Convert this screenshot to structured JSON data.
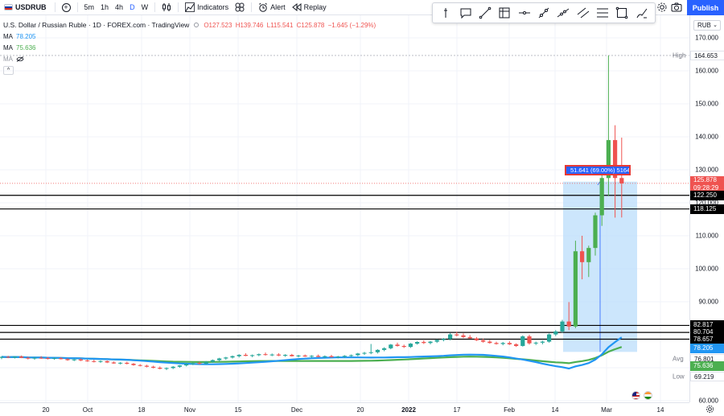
{
  "toolbar": {
    "symbol": "USDRUB",
    "intervals": [
      "5m",
      "1h",
      "4h",
      "D",
      "W"
    ],
    "active_interval": "D",
    "indicators_label": "Indicators",
    "alert_label": "Alert",
    "replay_label": "Replay",
    "publish_label": "Publish"
  },
  "legend": {
    "title": "U.S. Dollar / Russian Ruble · 1D · FOREX.com · TradingView",
    "open": "O127.523",
    "high": "H139.746",
    "low": "L115.541",
    "close": "C125.878",
    "change": "−1.645 (−1.29%)",
    "ma1_label": "MA",
    "ma1_value": "78.205",
    "ma2_label": "MA",
    "ma2_value": "75.636",
    "ma3_label": "MA"
  },
  "price_axis": {
    "currency": "RUB",
    "ticks": [
      "170.000",
      "160.000",
      "150.000",
      "140.000",
      "130.000",
      "120.000",
      "110.000",
      "100.000",
      "90.000",
      "80.000",
      "70.000",
      "60.000"
    ],
    "tags": {
      "high": "164.653",
      "high_label": "High",
      "last": "125.878",
      "countdown": "09:28:29",
      "line1": "122.250",
      "line2": "118.125",
      "line3": "82.817",
      "line4": "80.704",
      "line5": "78.657",
      "ma1": "78.205",
      "avg": "76.801",
      "avg_label": "Avg",
      "ma2": "75.636",
      "low": "69.219",
      "low_label": "Low"
    }
  },
  "time_axis": {
    "labels": [
      "20",
      "Oct",
      "18",
      "Nov",
      "15",
      "Dec",
      "20",
      "2022",
      "17",
      "Feb",
      "14",
      "Mar",
      "14"
    ]
  },
  "measure": {
    "label": "51.641 (69.00%) 5164"
  },
  "colors": {
    "up": "#26a69a",
    "down": "#ef5350",
    "up_bright": "#4caf50",
    "ma_blue": "#2196f3",
    "ma_green": "#4caf50",
    "accent": "#2962ff",
    "measure_fill": "#bbdefb"
  },
  "chart_data": {
    "type": "candlestick",
    "title": "U.S. Dollar / Russian Ruble · 1D · FOREX.com · TradingView",
    "y_range": [
      60,
      175
    ],
    "horizontal_lines": [
      122.25,
      118.125,
      82.817,
      80.704,
      78.657
    ],
    "last_price": 125.878,
    "session_high": 164.653,
    "session_low": 69.219,
    "candles": [
      {
        "o": 73.0,
        "h": 73.4,
        "l": 72.6,
        "c": 73.3
      },
      {
        "o": 73.3,
        "h": 73.6,
        "l": 72.9,
        "c": 73.1
      },
      {
        "o": 73.1,
        "h": 73.5,
        "l": 72.8,
        "c": 73.4
      },
      {
        "o": 73.4,
        "h": 73.7,
        "l": 72.9,
        "c": 73.0
      },
      {
        "o": 73.0,
        "h": 73.3,
        "l": 72.5,
        "c": 72.8
      },
      {
        "o": 72.8,
        "h": 73.2,
        "l": 72.4,
        "c": 73.0
      },
      {
        "o": 73.0,
        "h": 73.5,
        "l": 72.7,
        "c": 72.9
      },
      {
        "o": 72.9,
        "h": 73.3,
        "l": 72.5,
        "c": 72.7
      },
      {
        "o": 72.7,
        "h": 73.1,
        "l": 72.4,
        "c": 72.9
      },
      {
        "o": 72.9,
        "h": 73.2,
        "l": 72.5,
        "c": 72.6
      },
      {
        "o": 72.6,
        "h": 72.9,
        "l": 72.1,
        "c": 72.3
      },
      {
        "o": 72.3,
        "h": 72.7,
        "l": 72.0,
        "c": 72.5
      },
      {
        "o": 72.5,
        "h": 72.8,
        "l": 72.0,
        "c": 72.2
      },
      {
        "o": 72.2,
        "h": 72.5,
        "l": 71.8,
        "c": 72.0
      },
      {
        "o": 72.0,
        "h": 72.4,
        "l": 71.6,
        "c": 71.8
      },
      {
        "o": 71.8,
        "h": 72.2,
        "l": 71.5,
        "c": 72.0
      },
      {
        "o": 72.0,
        "h": 72.2,
        "l": 71.4,
        "c": 71.6
      },
      {
        "o": 71.6,
        "h": 71.9,
        "l": 71.2,
        "c": 71.3
      },
      {
        "o": 71.3,
        "h": 71.7,
        "l": 71.0,
        "c": 71.5
      },
      {
        "o": 71.5,
        "h": 71.8,
        "l": 71.0,
        "c": 71.2
      },
      {
        "o": 71.2,
        "h": 71.4,
        "l": 70.6,
        "c": 70.8
      },
      {
        "o": 70.8,
        "h": 71.1,
        "l": 70.4,
        "c": 70.6
      },
      {
        "o": 70.6,
        "h": 70.9,
        "l": 70.1,
        "c": 70.3
      },
      {
        "o": 70.3,
        "h": 70.6,
        "l": 69.8,
        "c": 70.0
      },
      {
        "o": 70.0,
        "h": 70.4,
        "l": 69.5,
        "c": 69.7
      },
      {
        "o": 69.7,
        "h": 70.1,
        "l": 69.3,
        "c": 69.9
      },
      {
        "o": 69.9,
        "h": 70.5,
        "l": 69.6,
        "c": 70.3
      },
      {
        "o": 70.3,
        "h": 70.8,
        "l": 70.0,
        "c": 70.7
      },
      {
        "o": 70.7,
        "h": 71.3,
        "l": 70.4,
        "c": 71.1
      },
      {
        "o": 71.1,
        "h": 71.6,
        "l": 70.8,
        "c": 71.4
      },
      {
        "o": 71.4,
        "h": 71.9,
        "l": 71.0,
        "c": 71.2
      },
      {
        "o": 71.2,
        "h": 72.0,
        "l": 71.0,
        "c": 71.8
      },
      {
        "o": 71.8,
        "h": 72.5,
        "l": 71.5,
        "c": 72.3
      },
      {
        "o": 72.3,
        "h": 73.0,
        "l": 72.0,
        "c": 72.8
      },
      {
        "o": 72.8,
        "h": 73.3,
        "l": 72.4,
        "c": 73.1
      },
      {
        "o": 73.1,
        "h": 73.7,
        "l": 72.8,
        "c": 73.5
      },
      {
        "o": 73.5,
        "h": 74.1,
        "l": 73.1,
        "c": 73.9
      },
      {
        "o": 73.9,
        "h": 74.4,
        "l": 73.5,
        "c": 73.6
      },
      {
        "o": 73.6,
        "h": 74.0,
        "l": 73.2,
        "c": 73.8
      },
      {
        "o": 73.8,
        "h": 74.3,
        "l": 73.5,
        "c": 74.1
      },
      {
        "o": 74.1,
        "h": 74.6,
        "l": 73.7,
        "c": 73.9
      },
      {
        "o": 73.9,
        "h": 74.3,
        "l": 73.5,
        "c": 74.0
      },
      {
        "o": 74.0,
        "h": 74.4,
        "l": 73.5,
        "c": 73.7
      },
      {
        "o": 73.7,
        "h": 74.1,
        "l": 73.3,
        "c": 73.9
      },
      {
        "o": 73.9,
        "h": 74.2,
        "l": 73.4,
        "c": 73.5
      },
      {
        "o": 73.5,
        "h": 73.9,
        "l": 73.1,
        "c": 73.7
      },
      {
        "o": 73.7,
        "h": 74.0,
        "l": 73.3,
        "c": 73.4
      },
      {
        "o": 73.4,
        "h": 73.8,
        "l": 73.0,
        "c": 73.6
      },
      {
        "o": 73.6,
        "h": 74.0,
        "l": 73.2,
        "c": 73.3
      },
      {
        "o": 73.3,
        "h": 73.7,
        "l": 72.9,
        "c": 73.5
      },
      {
        "o": 73.5,
        "h": 73.9,
        "l": 73.1,
        "c": 73.2
      },
      {
        "o": 73.2,
        "h": 73.6,
        "l": 72.8,
        "c": 73.4
      },
      {
        "o": 73.4,
        "h": 73.8,
        "l": 73.0,
        "c": 73.6
      },
      {
        "o": 73.6,
        "h": 74.0,
        "l": 73.3,
        "c": 73.8
      },
      {
        "o": 73.8,
        "h": 74.5,
        "l": 73.5,
        "c": 74.3
      },
      {
        "o": 74.3,
        "h": 74.8,
        "l": 73.9,
        "c": 74.5
      },
      {
        "o": 74.5,
        "h": 77.2,
        "l": 74.1,
        "c": 74.7
      },
      {
        "o": 74.7,
        "h": 75.6,
        "l": 74.3,
        "c": 75.4
      },
      {
        "o": 75.4,
        "h": 76.2,
        "l": 75.0,
        "c": 75.9
      },
      {
        "o": 75.9,
        "h": 77.2,
        "l": 75.6,
        "c": 77.0
      },
      {
        "o": 77.0,
        "h": 77.6,
        "l": 76.4,
        "c": 76.6
      },
      {
        "o": 76.6,
        "h": 77.0,
        "l": 76.0,
        "c": 76.3
      },
      {
        "o": 76.3,
        "h": 77.5,
        "l": 76.0,
        "c": 77.3
      },
      {
        "o": 77.3,
        "h": 78.0,
        "l": 77.0,
        "c": 77.8
      },
      {
        "o": 77.8,
        "h": 78.3,
        "l": 77.2,
        "c": 77.5
      },
      {
        "o": 77.5,
        "h": 78.1,
        "l": 77.1,
        "c": 77.9
      },
      {
        "o": 77.9,
        "h": 78.6,
        "l": 77.5,
        "c": 78.4
      },
      {
        "o": 78.4,
        "h": 79.0,
        "l": 78.0,
        "c": 78.7
      },
      {
        "o": 78.7,
        "h": 80.5,
        "l": 78.3,
        "c": 80.1
      },
      {
        "o": 80.1,
        "h": 80.9,
        "l": 79.5,
        "c": 79.8
      },
      {
        "o": 79.8,
        "h": 80.4,
        "l": 79.0,
        "c": 79.3
      },
      {
        "o": 79.3,
        "h": 79.9,
        "l": 78.8,
        "c": 78.9
      },
      {
        "o": 78.9,
        "h": 79.3,
        "l": 78.1,
        "c": 78.3
      },
      {
        "o": 78.3,
        "h": 78.8,
        "l": 77.6,
        "c": 77.9
      },
      {
        "o": 77.9,
        "h": 78.4,
        "l": 77.3,
        "c": 77.5
      },
      {
        "o": 77.5,
        "h": 77.9,
        "l": 77.0,
        "c": 77.2
      },
      {
        "o": 77.2,
        "h": 77.8,
        "l": 76.8,
        "c": 77.5
      },
      {
        "o": 77.5,
        "h": 78.0,
        "l": 76.9,
        "c": 77.1
      },
      {
        "o": 77.1,
        "h": 77.4,
        "l": 76.3,
        "c": 76.6
      },
      {
        "o": 76.6,
        "h": 79.8,
        "l": 76.4,
        "c": 79.5
      },
      {
        "o": 79.5,
        "h": 80.0,
        "l": 77.0,
        "c": 77.4
      },
      {
        "o": 77.4,
        "h": 77.9,
        "l": 76.9,
        "c": 77.6
      },
      {
        "o": 77.6,
        "h": 78.2,
        "l": 77.1,
        "c": 77.9
      },
      {
        "o": 77.9,
        "h": 80.4,
        "l": 77.6,
        "c": 80.1
      },
      {
        "o": 80.1,
        "h": 81.4,
        "l": 79.6,
        "c": 81.0
      },
      {
        "o": 81.0,
        "h": 84.5,
        "l": 80.6,
        "c": 84.0
      },
      {
        "o": 84.0,
        "h": 89.9,
        "l": 81.4,
        "c": 82.5
      },
      {
        "o": 82.5,
        "h": 108.5,
        "l": 82.0,
        "c": 105.3
      },
      {
        "o": 105.3,
        "h": 110.0,
        "l": 96.8,
        "c": 102.0
      },
      {
        "o": 102.0,
        "h": 107.0,
        "l": 97.5,
        "c": 106.3
      },
      {
        "o": 106.3,
        "h": 117.0,
        "l": 104.0,
        "c": 116.2
      },
      {
        "o": 116.2,
        "h": 130.0,
        "l": 113.0,
        "c": 127.5
      },
      {
        "o": 127.5,
        "h": 164.653,
        "l": 122.0,
        "c": 139.0
      },
      {
        "o": 139.0,
        "h": 143.5,
        "l": 115.5,
        "c": 127.5
      },
      {
        "o": 127.5,
        "h": 139.746,
        "l": 115.541,
        "c": 125.878
      }
    ],
    "moving_averages": [
      {
        "name": "MA",
        "value": 78.205,
        "color": "#2196f3"
      },
      {
        "name": "MA",
        "value": 75.636,
        "color": "#4caf50"
      }
    ],
    "measure": {
      "from": 74.8,
      "to": 126.4,
      "change": 51.641,
      "percent": 69.0
    }
  }
}
